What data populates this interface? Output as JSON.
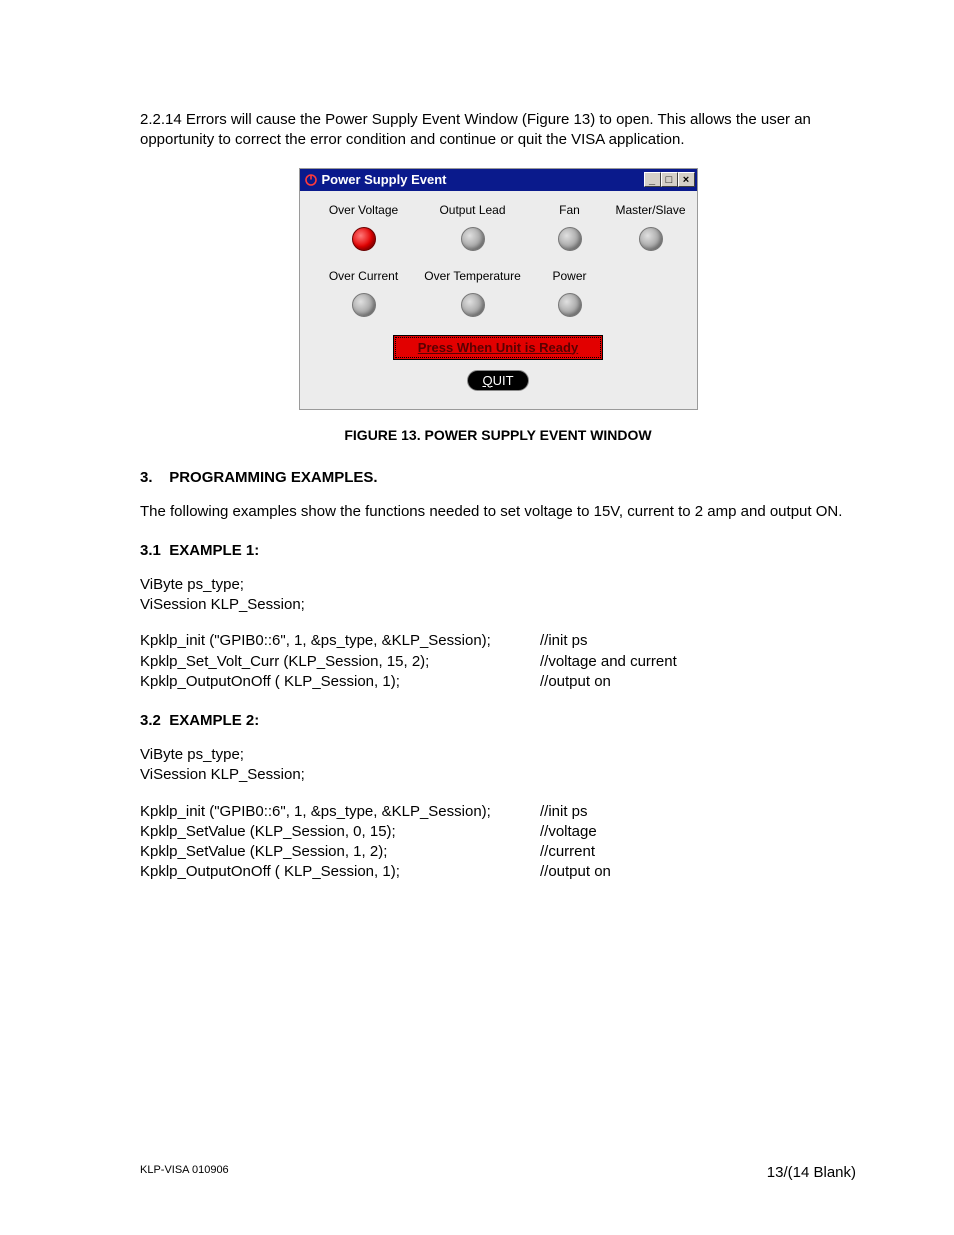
{
  "intro": {
    "num": "2.2.14",
    "text": "Errors will cause the Power Supply Event Window (Figure 13) to open. This allows the user an opportunity to correct the error condition and continue or quit the VISA application."
  },
  "window": {
    "title": "Power Supply Event",
    "btn_min": "_",
    "btn_max": "□",
    "btn_close": "×",
    "row1": [
      "Over Voltage",
      "Output Lead",
      "Fan",
      "Master/Slave"
    ],
    "row2": [
      "Over Current",
      "Over Temperature",
      "Power",
      ""
    ],
    "ready_label": "Press When Unit is Ready",
    "quit_label": "QUIT"
  },
  "figure_caption": "FIGURE 13.    POWER SUPPLY EVENT WINDOW",
  "sec3": {
    "num": "3.",
    "title": "PROGRAMMING EXAMPLES."
  },
  "sec3_intro": "The following examples show the functions needed to set voltage to 15V, current to 2 amp and output ON.",
  "ex1": {
    "num": "3.1",
    "title": "EXAMPLE 1:",
    "decl1": "ViByte ps_type;",
    "decl2": "ViSession KLP_Session;",
    "lines": [
      {
        "code": "Kpklp_init (\"GPIB0::6\", 1, &ps_type, &KLP_Session);",
        "comment": "//init ps"
      },
      {
        "code": "Kpklp_Set_Volt_Curr (KLP_Session, 15, 2);",
        "comment": "//voltage and current"
      },
      {
        "code": "Kpklp_OutputOnOff ( KLP_Session, 1);",
        "comment": "//output on"
      }
    ]
  },
  "ex2": {
    "num": "3.2",
    "title": "EXAMPLE 2:",
    "decl1": "ViByte ps_type;",
    "decl2": "ViSession KLP_Session;",
    "lines": [
      {
        "code": "Kpklp_init (\"GPIB0::6\", 1, &ps_type, &KLP_Session);",
        "comment": "//init ps"
      },
      {
        "code": "Kpklp_SetValue (KLP_Session, 0, 15);",
        "comment": "//voltage"
      },
      {
        "code": "Kpklp_SetValue (KLP_Session, 1, 2);",
        "comment": "//current"
      },
      {
        "code": "Kpklp_OutputOnOff ( KLP_Session, 1);",
        "comment": "//output on"
      }
    ]
  },
  "footer": {
    "left": "KLP-VISA 010906",
    "right": "13/(14 Blank)"
  }
}
